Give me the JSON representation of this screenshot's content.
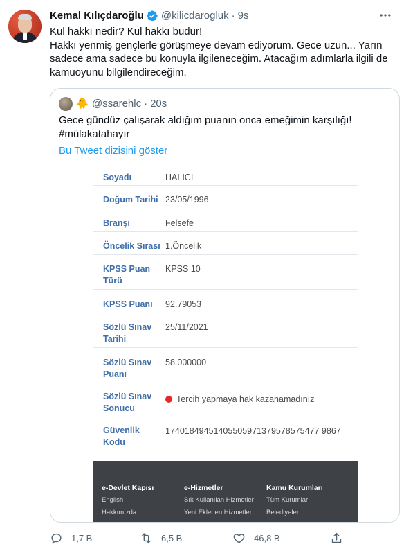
{
  "author": {
    "name": "Kemal Kılıçdaroğlu",
    "handle": "@kilicdarogluk",
    "separator": "·",
    "time": "9s"
  },
  "tweet_text": [
    "Kul hakkı nedir? Kul hakkı budur!",
    "Hakkı yenmiş gençlerle görüşmeye devam ediyorum. Gece uzun... Yarın sadece ama sadece bu konuyla ilgileneceğim. Atacağım adımlarla ilgili de kamuoyunu bilgilendireceğim."
  ],
  "quoted": {
    "emoji": "🐥",
    "handle": "@ssarehlc",
    "separator": "·",
    "time": "20s",
    "text_line1": "Gece gündüz çalışarak aldığım puanın onca emeğimin karşılığı!",
    "text_line2": "#mülakatahayır",
    "thread_link": "Bu Tweet dizisini göster",
    "form": [
      {
        "label": "Soyadı",
        "value": "HALICI"
      },
      {
        "label": "Doğum Tarihi",
        "value": "23/05/1996"
      },
      {
        "label": "Branşı",
        "value": "Felsefe"
      },
      {
        "label": "Öncelik Sırası",
        "value": "1.Öncelik"
      },
      {
        "label": "KPSS Puan Türü",
        "value": "KPSS 10"
      },
      {
        "label": "KPSS Puanı",
        "value": "92.79053"
      },
      {
        "label": "Sözlü Sınav Tarihi",
        "value": "25/11/2021"
      },
      {
        "label": "Sözlü Sınav Puanı",
        "value": "58.000000"
      },
      {
        "label": "Sözlü Sınav Sonucu",
        "value": "Tercih yapmaya hak kazanamadınız"
      },
      {
        "label": "Güvenlik Kodu",
        "value": "17401849451405505971379578575477 9867"
      }
    ],
    "footer": [
      {
        "title": "e-Devlet Kapısı",
        "items": [
          "English",
          "Hakkımızda"
        ]
      },
      {
        "title": "e-Hizmetler",
        "items": [
          "Sık Kullanılan Hizmetler",
          "Yeni Eklenen Hizmetler"
        ]
      },
      {
        "title": "Kamu Kurumları",
        "items": [
          "Tüm Kurumlar",
          "Belediyeler"
        ]
      }
    ]
  },
  "actions": {
    "replies": "1,7 B",
    "retweets": "6,5 B",
    "likes": "46,8 B"
  },
  "colors": {
    "accent": "#1d9bf0",
    "secondary_text": "#536471",
    "form_label": "#3f6ea8",
    "status_red": "#e8262b"
  }
}
